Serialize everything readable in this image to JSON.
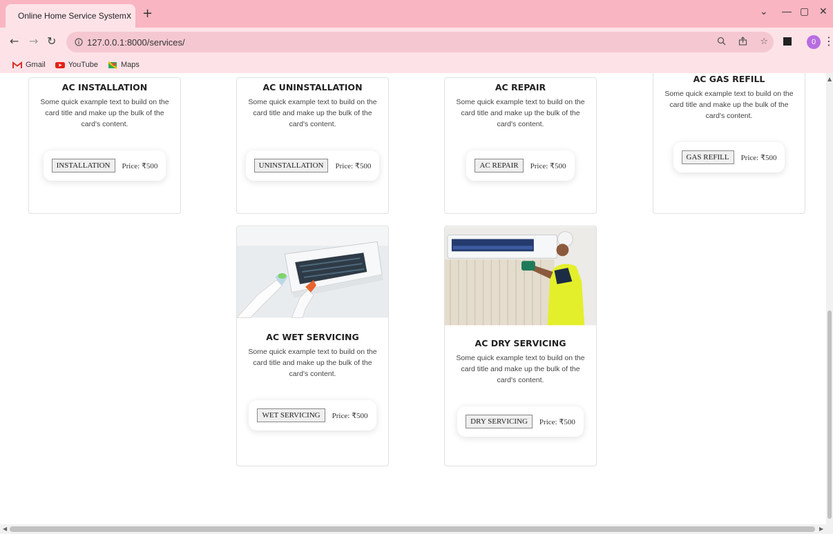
{
  "browser": {
    "tab_title": "Online Home Service System",
    "tab_close": "x",
    "new_tab": "+",
    "win_controls": {
      "minimize": "—",
      "restore": "▢",
      "close": "✕",
      "dropdown": "⌄"
    },
    "url": "127.0.0.1:8000/services/",
    "profile_initial": "0",
    "bookmarks": [
      {
        "label": "Gmail",
        "icon": "gmail-icon"
      },
      {
        "label": "YouTube",
        "icon": "youtube-icon"
      },
      {
        "label": "Maps",
        "icon": "maps-icon"
      }
    ]
  },
  "colors": {
    "tabstrip": "#f9b5c2",
    "toolbar": "#fde3e8"
  },
  "cards": [
    {
      "title": "AC INSTALLATION",
      "text": "Some quick example text to build on the card title and make up the bulk of the card's content.",
      "button": "INSTALLATION",
      "price": "Price: ₹500"
    },
    {
      "title": "AC UNINSTALLATION",
      "text": "Some quick example text to build on the card title and make up the bulk of the card's content.",
      "button": "UNINSTALLATION",
      "price": "Price: ₹500"
    },
    {
      "title": "AC REPAIR",
      "text": "Some quick example text to build on the card title and make up the bulk of the card's content.",
      "button": "AC REPAIR",
      "price": "Price: ₹500"
    },
    {
      "title": "AC GAS REFILL",
      "text": "Some quick example text to build on the card title and make up the bulk of the card's content.",
      "button": "GAS REFILL",
      "price": "Price: ₹500"
    },
    {
      "title": "AC WET SERVICING",
      "text": "Some quick example text to build on the card title and make up the bulk of the card's content.",
      "button": "WET SERVICING",
      "price": "Price: ₹500"
    },
    {
      "title": "AC DRY SERVICING",
      "text": "Some quick example text to build on the card title and make up the bulk of the card's content.",
      "button": "DRY SERVICING",
      "price": "Price: ₹500"
    }
  ]
}
